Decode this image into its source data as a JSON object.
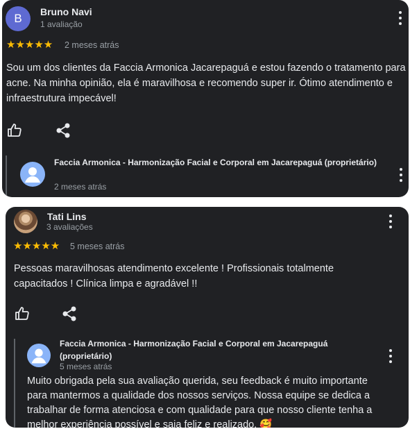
{
  "reviews": [
    {
      "reviewer": {
        "name": "Bruno Navi",
        "initial": "B",
        "count": "1 avaliação",
        "avatar_color": "#5e6ad2"
      },
      "rating": 5,
      "stars": "★★★★★",
      "date": "2 meses atrás",
      "text": "Sou um dos clientes da Faccia Armonica Jacarepaguá e estou fazendo o tratamento para acne. Na minha opinião, ela é maravilhosa e recomendo super ir. Ótimo atendimento e infraestrutura impecável!",
      "actions": {
        "like_icon": "thumbs-up-icon",
        "share_icon": "share-icon",
        "more_icon": "more-vertical-icon"
      },
      "owner_reply": {
        "name": "Faccia Armonica - Harmonização Facial e Corporal em Jacarepaguá (proprietário)",
        "date": "2 meses atrás",
        "text": ""
      }
    },
    {
      "reviewer": {
        "name": "Tati Lins",
        "count": "3 avaliações"
      },
      "rating": 5,
      "stars": "★★★★★",
      "date": "5 meses atrás",
      "text": "Pessoas maravilhosas atendimento excelente ! Profissionais totalmente capacitados ! Clínica limpa e agradável !!",
      "actions": {
        "like_icon": "thumbs-up-icon",
        "share_icon": "share-icon",
        "more_icon": "more-vertical-icon"
      },
      "owner_reply": {
        "name": "Faccia Armonica - Harmonização Facial e Corporal em Jacarepaguá (proprietário)",
        "date": "5 meses atrás",
        "text": "Muito obrigada pela sua avaliação querida, seu feedback é muito importante para mantermos a qualidade dos nossos serviços. Nossa equipe se dedica a trabalhar de forma atenciosa e com qualidade para que nosso cliente tenha a melhor experiência possível e saia feliz e realizado. 🥰"
      }
    }
  ],
  "colors": {
    "card_bg": "#202124",
    "text_primary": "#e8eaed",
    "text_secondary": "#9aa0a6",
    "star": "#fbbc04",
    "owner_avatar": "#8ab4f8"
  }
}
